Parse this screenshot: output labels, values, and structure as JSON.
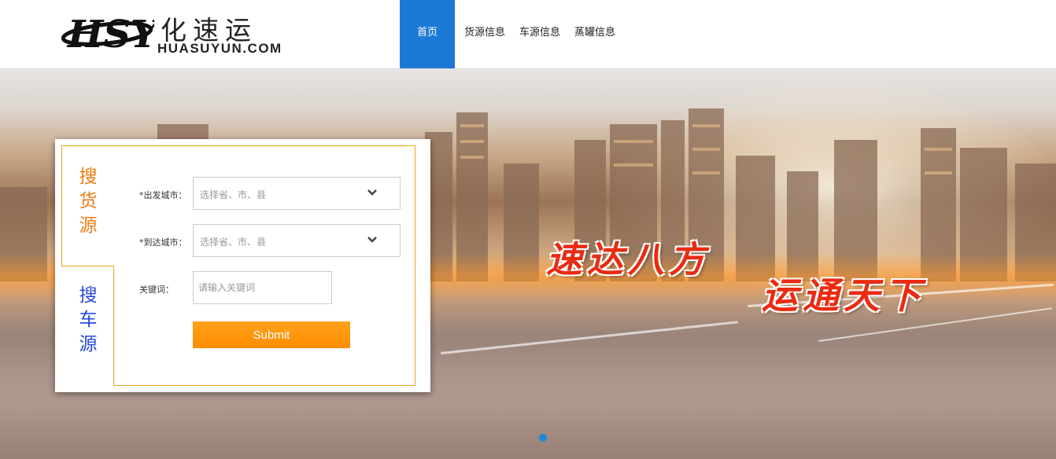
{
  "brand": {
    "name_cn": "化速运",
    "name_en": "HUASUYUN.COM",
    "accent_color": "#1c7ad6"
  },
  "nav": {
    "items": [
      {
        "label": "首页",
        "active": true
      },
      {
        "label": "货源信息",
        "active": false
      },
      {
        "label": "车源信息",
        "active": false
      },
      {
        "label": "蒸罐信息",
        "active": false
      }
    ]
  },
  "banner": {
    "slogan_line1": "速达八方",
    "slogan_line2": "运通天下",
    "slide_count": 1,
    "active_slide": 1
  },
  "search": {
    "tabs": [
      {
        "label": "搜货源",
        "chars": [
          "搜",
          "货",
          "源"
        ],
        "active": true,
        "color": "#f07a10"
      },
      {
        "label": "搜车源",
        "chars": [
          "搜",
          "车",
          "源"
        ],
        "active": false,
        "color": "#2848d6"
      }
    ],
    "origin": {
      "label": "*出发城市：",
      "placeholder": "选择省、市、县"
    },
    "destination": {
      "label": "*到达城市：",
      "placeholder": "选择省、市、县"
    },
    "keyword": {
      "label": "关键词：",
      "placeholder": "请输入关键词",
      "value": ""
    },
    "submit_label": "Submit",
    "submit_color": "#ff8c00"
  }
}
